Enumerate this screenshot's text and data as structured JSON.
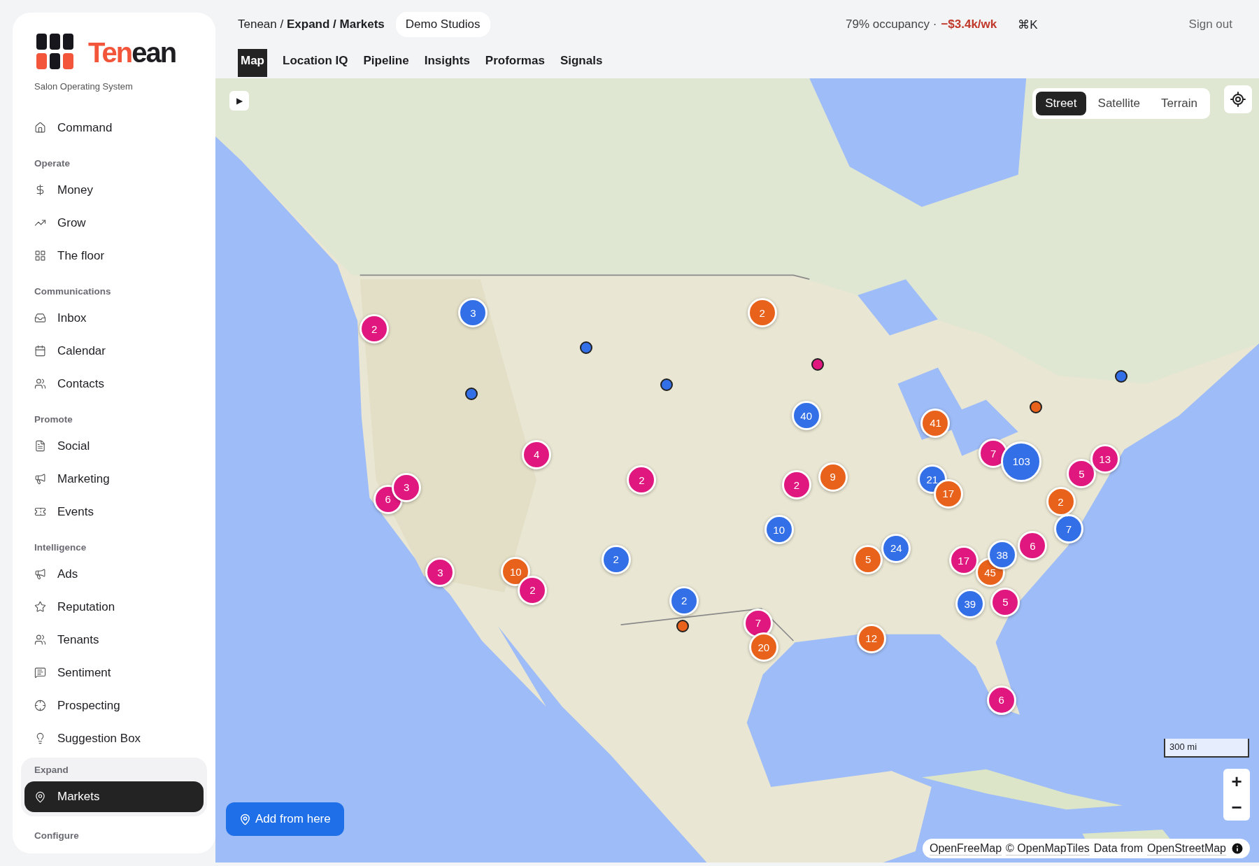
{
  "sidebar": {
    "logo": {
      "accent": "Ten",
      "rest": "ean"
    },
    "tagline": "Salon Operating System",
    "groups": [
      {
        "items": [
          {
            "label": "Command",
            "selected": false
          }
        ]
      },
      {
        "heading": "Operate",
        "items": [
          {
            "label": "Money",
            "selected": false
          },
          {
            "label": "Grow",
            "selected": false
          },
          {
            "label": "The floor",
            "selected": false
          }
        ]
      },
      {
        "heading": "Communications",
        "items": [
          {
            "label": "Inbox",
            "selected": false
          },
          {
            "label": "Calendar",
            "selected": false
          },
          {
            "label": "Contacts",
            "selected": false
          }
        ]
      },
      {
        "heading": "Promote",
        "items": [
          {
            "label": "Social",
            "selected": false
          },
          {
            "label": "Marketing",
            "selected": false
          },
          {
            "label": "Events",
            "selected": false
          }
        ]
      },
      {
        "heading": "Intelligence",
        "items": [
          {
            "label": "Ads",
            "selected": false
          },
          {
            "label": "Reputation",
            "selected": false
          },
          {
            "label": "Tenants",
            "selected": false
          },
          {
            "label": "Sentiment",
            "selected": false
          },
          {
            "label": "Prospecting",
            "selected": false
          },
          {
            "label": "Suggestion Box",
            "selected": false
          }
        ]
      },
      {
        "heading": "Expand",
        "items": [
          {
            "label": "Markets",
            "selected": true
          }
        ]
      },
      {
        "heading": "Configure"
      }
    ]
  },
  "header": {
    "breadcrumb": "Tenean / **Expand / Markets**",
    "workspace": "Demo Studios",
    "occupancy": "79% occupancy ·",
    "delta": "−$3.4k/wk",
    "shortcut": "⌘K",
    "sign_out": "Sign out"
  },
  "tabs": [
    {
      "label": "Map",
      "selected": true
    },
    {
      "label": "Location IQ",
      "selected": false
    },
    {
      "label": "Pipeline",
      "selected": false
    },
    {
      "label": "Insights",
      "selected": false
    },
    {
      "label": "Proformas",
      "selected": false
    },
    {
      "label": "Signals",
      "selected": false
    }
  ],
  "map": {
    "play": "▶",
    "styles": [
      {
        "label": "Street",
        "selected": true
      },
      {
        "label": "Satellite",
        "selected": false
      },
      {
        "label": "Terrain",
        "selected": false
      }
    ],
    "markers": [
      {
        "kind": "cluster",
        "count": "2",
        "color": "#e0177f"
      },
      {
        "kind": "cluster",
        "count": "3",
        "color": "#336fe6"
      },
      {
        "kind": "cluster",
        "count": "2",
        "color": "#e8621c"
      },
      {
        "kind": "point",
        "color": "#336fe6"
      },
      {
        "kind": "point",
        "color": "#336fe6"
      },
      {
        "kind": "point",
        "color": "#336fe6"
      },
      {
        "kind": "point",
        "color": "#e0177f"
      },
      {
        "kind": "point",
        "color": "#336fe6"
      },
      {
        "kind": "cluster",
        "count": "40",
        "color": "#336fe6"
      },
      {
        "kind": "cluster",
        "count": "41",
        "color": "#e8621c"
      },
      {
        "kind": "point",
        "color": "#e8621c"
      },
      {
        "kind": "cluster",
        "count": "6",
        "color": "#e0177f"
      },
      {
        "kind": "cluster",
        "count": "3",
        "color": "#e0177f"
      },
      {
        "kind": "cluster",
        "count": "4",
        "color": "#e0177f"
      },
      {
        "kind": "cluster",
        "count": "2",
        "color": "#e0177f"
      },
      {
        "kind": "cluster",
        "count": "2",
        "color": "#e0177f"
      },
      {
        "kind": "cluster",
        "count": "9",
        "color": "#e8621c"
      },
      {
        "kind": "cluster",
        "count": "21",
        "color": "#336fe6"
      },
      {
        "kind": "cluster",
        "count": "17",
        "color": "#e8621c"
      },
      {
        "kind": "cluster",
        "count": "7",
        "color": "#e0177f"
      },
      {
        "kind": "cluster",
        "count": "103",
        "color": "#336fe6"
      },
      {
        "kind": "cluster",
        "count": "2",
        "color": "#e8621c"
      },
      {
        "kind": "cluster",
        "count": "5",
        "color": "#e0177f"
      },
      {
        "kind": "cluster",
        "count": "13",
        "color": "#e0177f"
      },
      {
        "kind": "cluster",
        "count": "3",
        "color": "#e0177f"
      },
      {
        "kind": "cluster",
        "count": "10",
        "color": "#e8621c"
      },
      {
        "kind": "cluster",
        "count": "2",
        "color": "#336fe6"
      },
      {
        "kind": "cluster",
        "count": "10",
        "color": "#336fe6"
      },
      {
        "kind": "cluster",
        "count": "5",
        "color": "#e8621c"
      },
      {
        "kind": "cluster",
        "count": "24",
        "color": "#336fe6"
      },
      {
        "kind": "cluster",
        "count": "17",
        "color": "#e0177f"
      },
      {
        "kind": "cluster",
        "count": "45",
        "color": "#e8621c"
      },
      {
        "kind": "cluster",
        "count": "38",
        "color": "#336fe6"
      },
      {
        "kind": "cluster",
        "count": "6",
        "color": "#e0177f"
      },
      {
        "kind": "cluster",
        "count": "7",
        "color": "#336fe6"
      },
      {
        "kind": "cluster",
        "count": "2",
        "color": "#e0177f"
      },
      {
        "kind": "point",
        "color": "#e8621c"
      },
      {
        "kind": "cluster",
        "count": "2",
        "color": "#336fe6"
      },
      {
        "kind": "cluster",
        "count": "7",
        "color": "#e0177f"
      },
      {
        "kind": "cluster",
        "count": "20",
        "color": "#e8621c"
      },
      {
        "kind": "cluster",
        "count": "12",
        "color": "#e8621c"
      },
      {
        "kind": "cluster",
        "count": "39",
        "color": "#336fe6"
      },
      {
        "kind": "cluster",
        "count": "5",
        "color": "#e0177f"
      },
      {
        "kind": "cluster",
        "count": "6",
        "color": "#e0177f"
      }
    ],
    "scale": "300 mi",
    "zoom_in": "+",
    "zoom_out": "−",
    "add_button": "Add from here",
    "attribution": [
      {
        "kind": "link",
        "text": "OpenFreeMap"
      },
      {
        "kind": "link",
        "text": "© OpenMapTiles"
      },
      {
        "kind": "text",
        "text": "Data from"
      },
      {
        "kind": "link",
        "text": "OpenStreetMap"
      }
    ]
  }
}
